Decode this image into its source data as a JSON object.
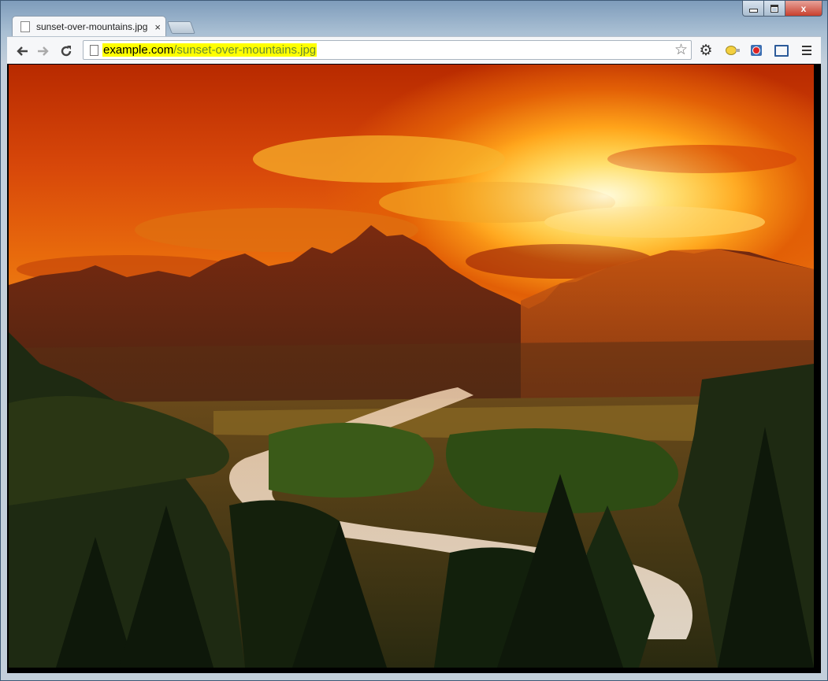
{
  "browser": {
    "tab": {
      "title": "sunset-over-mountains.jpg",
      "close_label": "×"
    },
    "toolbar": {
      "back_icon": "arrow-left-icon",
      "forward_icon": "arrow-right-icon",
      "reload_icon": "reload-icon",
      "url_host": "example.com",
      "url_path": "/sunset-over-mountains.jpg",
      "bookmark_icon": "star-icon",
      "settings_icon": "gear-icon",
      "bulb_icon": "lightbulb-icon",
      "extension_icon": "extension-icon",
      "cast_icon": "fullscreen-icon",
      "menu_icon": "menu-icon"
    },
    "window_controls": {
      "minimize": "minimize-icon",
      "maximize": "maximize-icon",
      "close_label": "x"
    }
  },
  "content": {
    "image_description_icon": "sunset-photo"
  },
  "colors": {
    "url_highlight": "#ffff00",
    "url_path": "#6a8c2f",
    "close_button": "#c8402e"
  }
}
